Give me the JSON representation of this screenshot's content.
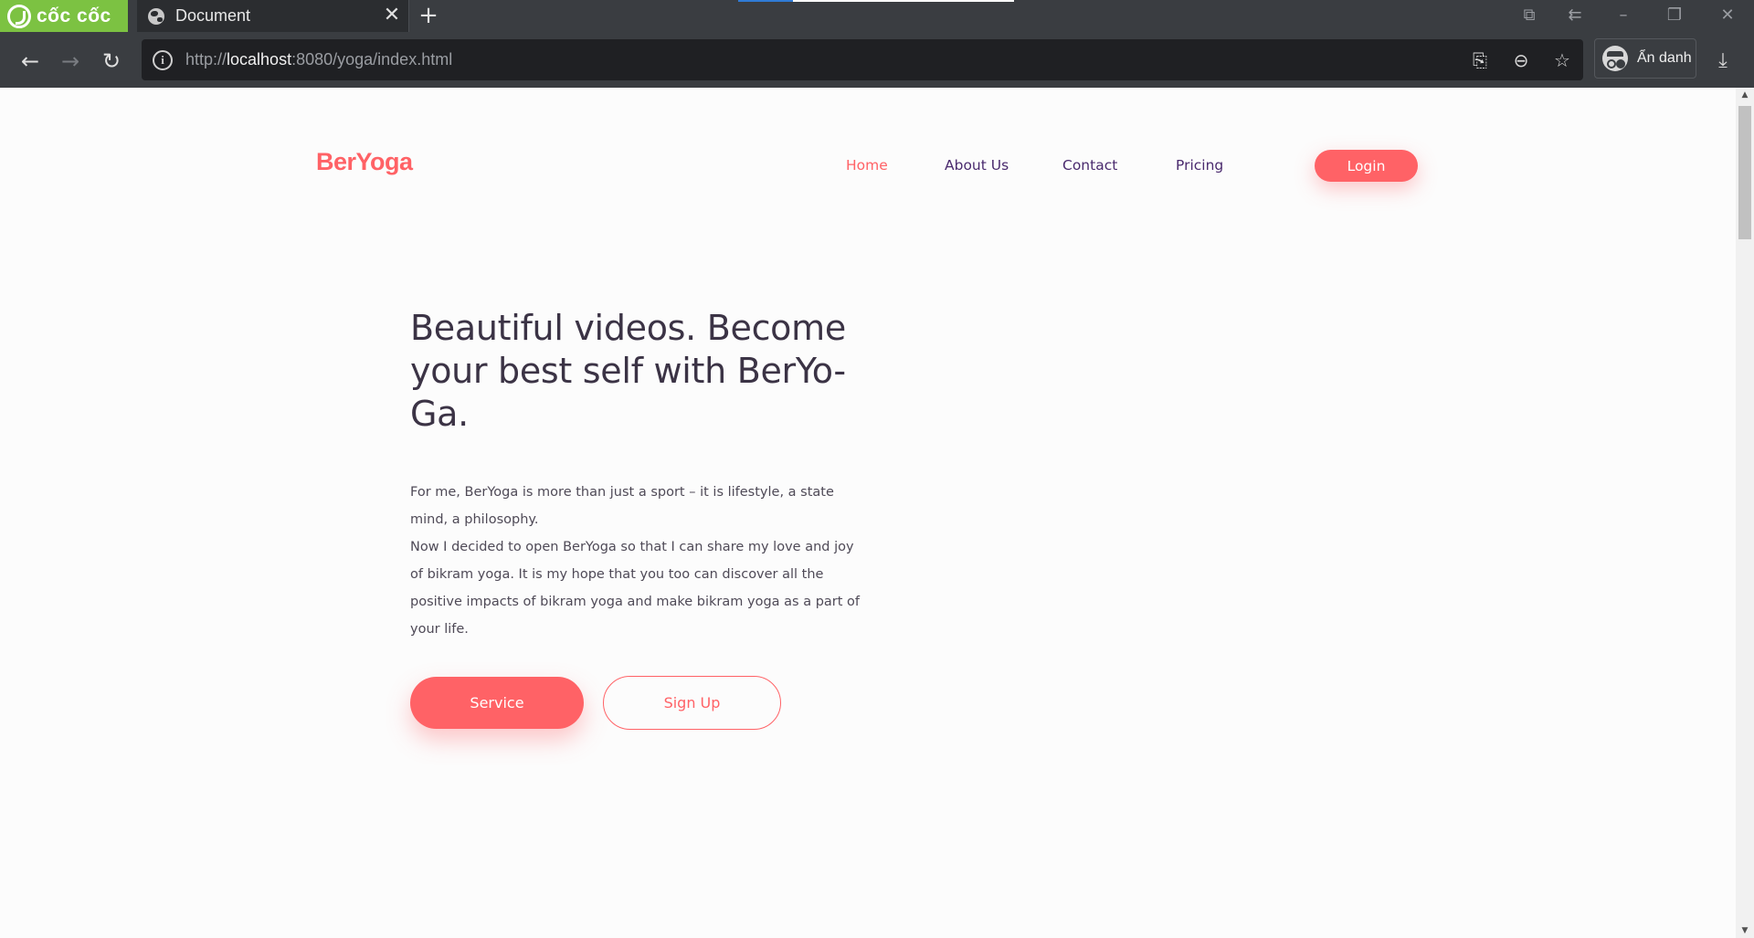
{
  "browser": {
    "brand_name": "cốc cốc",
    "tab_title": "Document",
    "url_prefix": "http://",
    "url_host": "localhost",
    "url_path": ":8080/yoga/index.html",
    "incognito_label": "Ẩn danh"
  },
  "icons": {
    "back": "arrow-left",
    "forward": "arrow-right",
    "reload": "refresh",
    "info": "info-circle",
    "translate": "translate",
    "zoom": "zoom-out",
    "bookmark": "star",
    "download": "download",
    "new_tab": "plus",
    "close_tab": "close"
  },
  "colors": {
    "accent": "#ff6266",
    "nav_text": "#4a2a6e",
    "heading": "#3b3345",
    "browser_brand": "#7cc242"
  },
  "site": {
    "logo": "BerYoga",
    "nav": [
      {
        "label": "Home",
        "active": true
      },
      {
        "label": "About Us",
        "active": false
      },
      {
        "label": "Contact",
        "active": false
      },
      {
        "label": "Pricing",
        "active": false
      }
    ],
    "login_label": "Login"
  },
  "hero": {
    "title": "Beautiful videos. Become your best self with BerYo-Ga.",
    "paragraph_1": "For me, BerYoga is more than just a sport – it is lifestyle, a state mind, a philosophy.",
    "paragraph_2": "Now I decided to open BerYoga so that I can share my love and joy of bikram yoga. It is my hope that you too can discover all the positive impacts of bikram yoga and make bikram yoga as a part of your life.",
    "service_label": "Service",
    "signup_label": "Sign Up"
  }
}
